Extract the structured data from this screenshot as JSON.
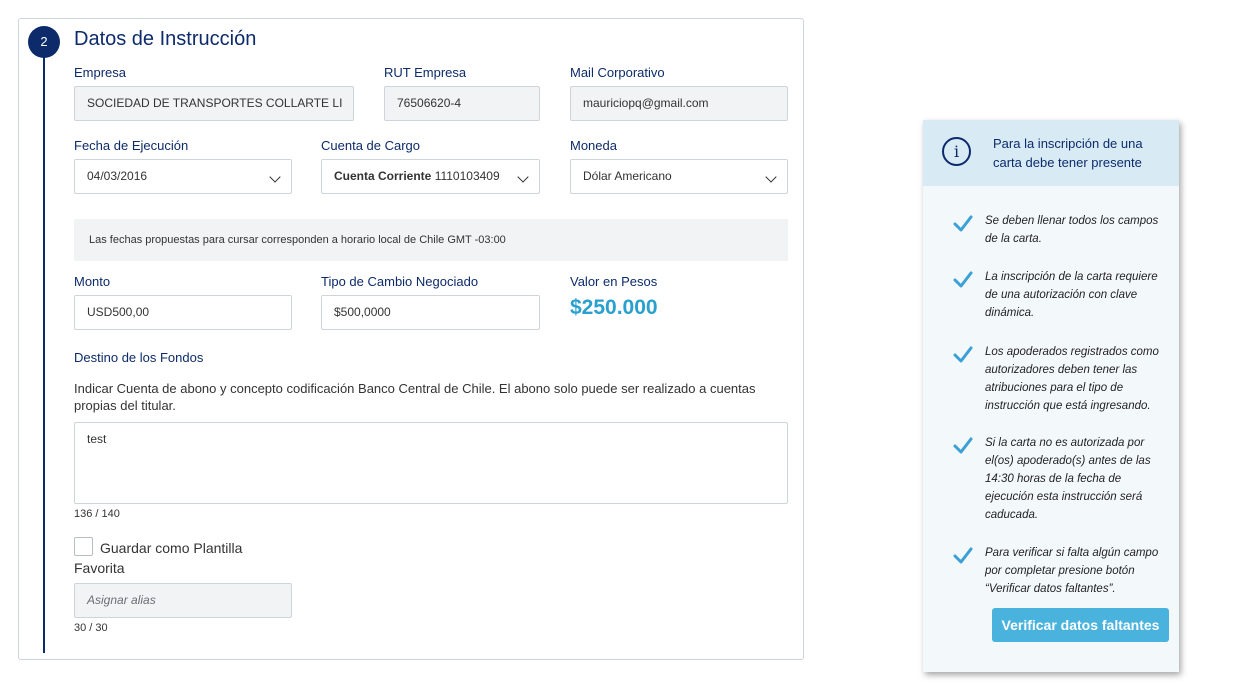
{
  "section": {
    "step_number": "2",
    "title": "Datos de Instrucción"
  },
  "fields": {
    "empresa": {
      "label": "Empresa",
      "value": "SOCIEDAD DE TRANSPORTES COLLARTE LI"
    },
    "rut": {
      "label": "RUT Empresa",
      "value": "76506620-4"
    },
    "mail": {
      "label": "Mail Corporativo",
      "value": "mauriciopq@gmail.com"
    },
    "fecha": {
      "label": "Fecha de Ejecución",
      "value": "04/03/2016"
    },
    "cuenta": {
      "label": "Cuenta de Cargo",
      "value_bold": "Cuenta Corriente",
      "value": "1110103409"
    },
    "moneda": {
      "label": "Moneda",
      "value": "Dólar Americano"
    },
    "monto": {
      "label": "Monto",
      "value": "USD500,00"
    },
    "tipo_cambio": {
      "label": "Tipo de Cambio Negociado",
      "value": "$500,0000"
    },
    "valor_pesos": {
      "label": "Valor en Pesos",
      "value": "$250.000"
    }
  },
  "notice": "Las fechas propuestas para cursar corresponden a horario local de Chile GMT -03:00",
  "destino": {
    "label": "Destino de los Fondos",
    "help": "Indicar  Cuenta de abono y concepto codificación Banco Central de Chile. El abono solo puede ser realizado a cuentas propias del titular.",
    "value": "test",
    "counter": "136 / 140"
  },
  "template": {
    "checkbox_label_line1": "Guardar como Plantilla",
    "checkbox_label_line2": "Favorita",
    "alias_placeholder": "Asignar alias",
    "counter": "30 / 30"
  },
  "panel": {
    "title": "Para la inscripción de una carta debe tener presente",
    "info_icon": "i",
    "tips": [
      "Se deben llenar todos los campos de la carta.",
      "La inscripción de la carta requiere de una autorización con clave dinámica.",
      "Los apoderados registrados como autorizadores deben tener las atribuciones para el tipo de instrucción que está ingresando.",
      "Si la carta no es autorizada por el(os) apoderado(s) antes de las 14:30 horas de la fecha de ejecución esta instrucción será caducada.",
      "Para verificar si falta algún campo por completar presione botón “Verificar datos faltantes”."
    ],
    "button_label": "Verificar datos faltantes"
  },
  "colors": {
    "primary": "#0d2b6b",
    "accent": "#2aa0cf",
    "button": "#49b3de",
    "check": "#3aa0d5"
  }
}
